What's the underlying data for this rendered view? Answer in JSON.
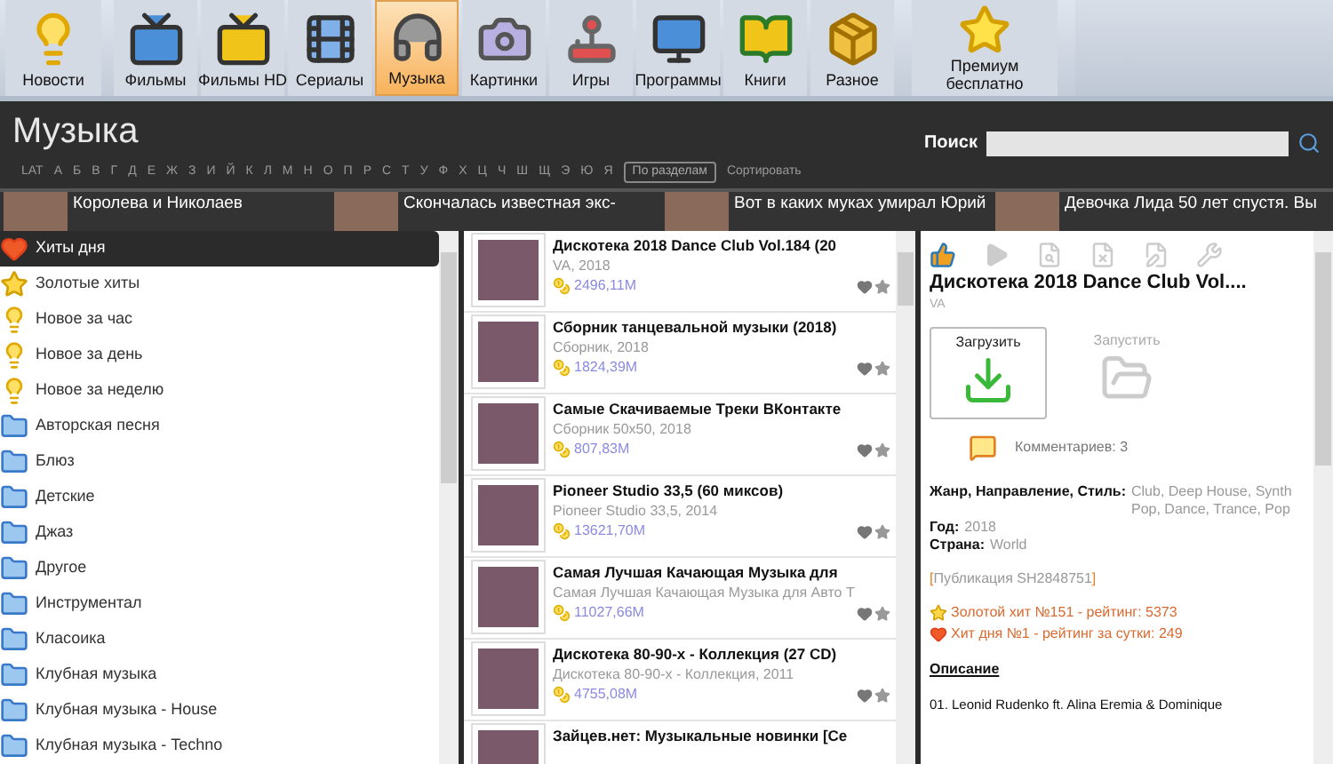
{
  "nav": [
    {
      "label": "Новости",
      "kind": "bulb",
      "selected": false
    },
    {
      "label": "Фильмы",
      "kind": "tv",
      "selected": false
    },
    {
      "label": "Фильмы HD",
      "kind": "hd",
      "selected": false
    },
    {
      "label": "Сериалы",
      "kind": "film",
      "selected": false
    },
    {
      "label": "Музыка",
      "kind": "music",
      "selected": true
    },
    {
      "label": "Картинки",
      "kind": "camera",
      "selected": false
    },
    {
      "label": "Игры",
      "kind": "joystick",
      "selected": false
    },
    {
      "label": "Программы",
      "kind": "pc",
      "selected": false
    },
    {
      "label": "Книги",
      "kind": "books",
      "selected": false
    },
    {
      "label": "Разное",
      "kind": "box",
      "selected": false
    }
  ],
  "premium": {
    "label": "Премиум бесплатно"
  },
  "header": {
    "title": "Музыка",
    "search_label": "Поиск"
  },
  "letters": [
    "LAT",
    "А",
    "Б",
    "В",
    "Г",
    "Д",
    "Е",
    "Ж",
    "З",
    "И",
    "Й",
    "К",
    "Л",
    "М",
    "Н",
    "О",
    "П",
    "Р",
    "С",
    "Т",
    "У",
    "Ф",
    "Х",
    "Ц",
    "Ч",
    "Ш",
    "Щ",
    "Э",
    "Ю",
    "Я"
  ],
  "sections_button": "По разделам",
  "sort_link": "Сортировать",
  "news": [
    "Королева и Николаев",
    "Скончалась известная экс-",
    "Вот в каких муках умирал Юрий",
    "Девочка Лида 50 лет спустя. Вы"
  ],
  "categories": [
    {
      "label": "Хиты дня",
      "kind": "heart",
      "selected": true
    },
    {
      "label": "Золотые хиты",
      "kind": "star",
      "selected": false
    },
    {
      "label": "Новое за час",
      "kind": "bulb",
      "selected": false
    },
    {
      "label": "Новое за день",
      "kind": "bulb",
      "selected": false
    },
    {
      "label": "Новое за неделю",
      "kind": "bulb",
      "selected": false
    },
    {
      "label": "Авторская песня",
      "kind": "folder",
      "selected": false
    },
    {
      "label": "Блюз",
      "kind": "folder",
      "selected": false
    },
    {
      "label": "Детские",
      "kind": "folder",
      "selected": false
    },
    {
      "label": "Джаз",
      "kind": "folder",
      "selected": false
    },
    {
      "label": "Другое",
      "kind": "folder",
      "selected": false
    },
    {
      "label": "Инструментал",
      "kind": "folder",
      "selected": false
    },
    {
      "label": "Класоика",
      "kind": "folder",
      "selected": false
    },
    {
      "label": "Клубная музыка",
      "kind": "folder",
      "selected": false
    },
    {
      "label": "Клубная музыка - House",
      "kind": "folder",
      "selected": false
    },
    {
      "label": "Клубная музыка - Techno",
      "kind": "folder",
      "selected": false
    }
  ],
  "releases": [
    {
      "title": "Дискотека 2018 Dance Club Vol.184 (20",
      "subtitle": "VA, 2018",
      "size": "2496,11M"
    },
    {
      "title": "Сборник танцевальной музыки (2018)",
      "subtitle": "Сборник, 2018",
      "size": "1824,39M"
    },
    {
      "title": "Самые Скачиваемые Треки ВКонтакте",
      "subtitle": "Сборник 50x50, 2018",
      "size": "807,83M"
    },
    {
      "title": "Pioneer Studio 33,5 (60 миксов)",
      "subtitle": "Pioneer Studio 33,5, 2014",
      "size": "13621,70M"
    },
    {
      "title": "Самая Лучшая Качающая Музыка для",
      "subtitle": "Самая Лучшая Качающая Музыка для Авто Т",
      "size": "11027,66M"
    },
    {
      "title": "Дискотека 80-90-х - Коллекция (27 CD)",
      "subtitle": "Дискотека 80-90-х - Коллекция, 2011",
      "size": "4755,08M"
    },
    {
      "title": "Зайцев.нет: Музыкальные новинки [Се"
    }
  ],
  "detail": {
    "title": "Дискотека 2018 Dance Club Vol....",
    "artist": "VA",
    "actions": [
      {
        "label": "Загрузить",
        "kind": "download",
        "disabled": false
      },
      {
        "label": "Запустить",
        "kind": "run",
        "disabled": true
      }
    ],
    "comments": "Комментариев: 3",
    "info": [
      {
        "label": "Жанр, Направление, Стиль:",
        "value": "Club, Deep House, Synth Pop, Dance, Trance, Pop"
      },
      {
        "label": "Год:",
        "value": "2018"
      },
      {
        "label": "Страна:",
        "value": "World"
      }
    ],
    "publication": {
      "open": "[",
      "text": "Публикация SH2848751",
      "close": "]"
    },
    "ratings": [
      {
        "kind": "star",
        "text": "Золотой хит №151 - рейтинг: 5373"
      },
      {
        "kind": "heart",
        "text": "Хит дня №1 - рейтинг за сутки: 249"
      }
    ],
    "description_heading": "Описание",
    "description": "01. Leonid Rudenko ft. Alina Eremia & Dominique"
  }
}
